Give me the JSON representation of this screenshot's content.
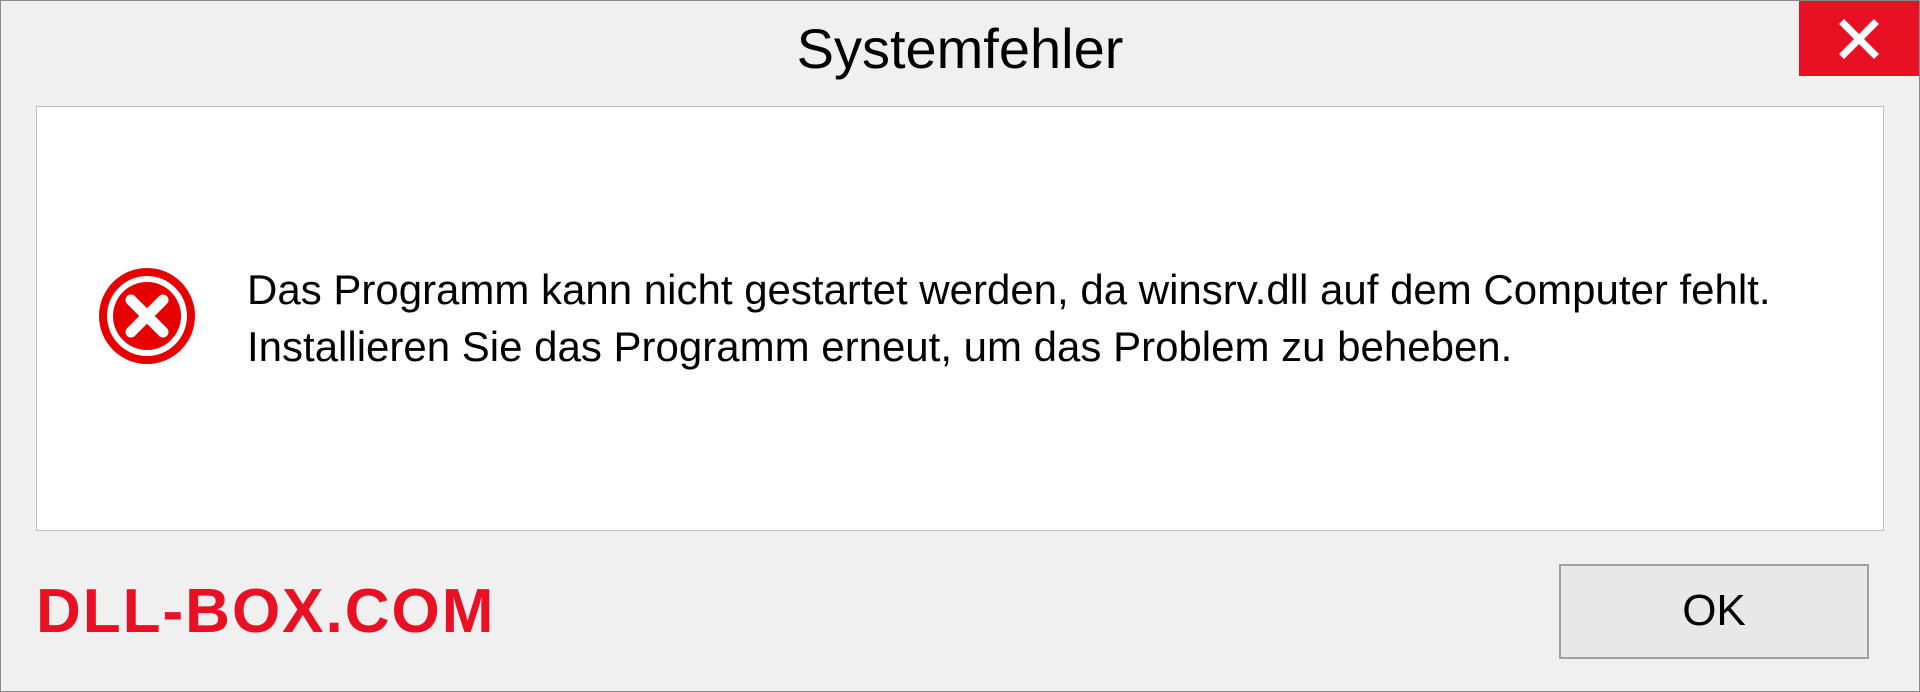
{
  "dialog": {
    "title": "Systemfehler",
    "message": "Das Programm kann nicht gestartet werden, da winsrv.dll auf dem Computer fehlt. Installieren Sie das Programm erneut, um das Problem zu beheben.",
    "ok_label": "OK",
    "watermark": "DLL-BOX.COM"
  },
  "colors": {
    "error_red": "#e81123",
    "dialog_bg": "#f0f0f0",
    "content_bg": "#ffffff"
  }
}
